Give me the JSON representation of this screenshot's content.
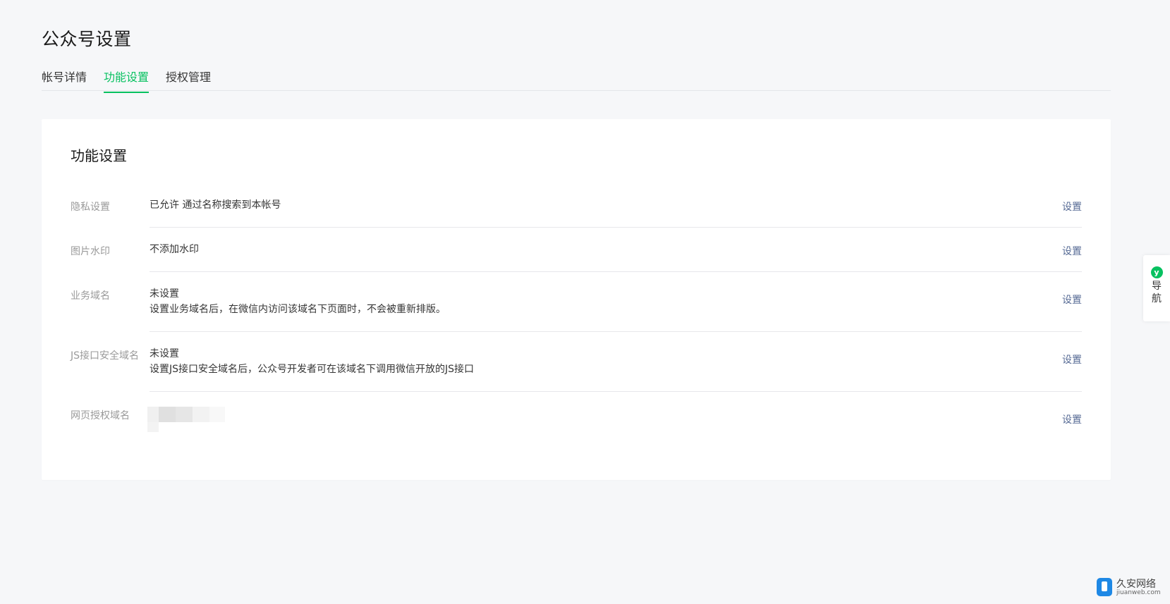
{
  "page": {
    "title": "公众号设置"
  },
  "tabs": [
    {
      "label": "帐号详情",
      "active": false
    },
    {
      "label": "功能设置",
      "active": true
    },
    {
      "label": "授权管理",
      "active": false
    }
  ],
  "card": {
    "title": "功能设置",
    "rows": [
      {
        "label": "隐私设置",
        "value": "已允许 通过名称搜索到本帐号",
        "desc": "",
        "action": "设置"
      },
      {
        "label": "图片水印",
        "value": "不添加水印",
        "desc": "",
        "action": "设置"
      },
      {
        "label": "业务域名",
        "value": "未设置",
        "desc": "设置业务域名后，在微信内访问该域名下页面时，不会被重新排版。",
        "action": "设置"
      },
      {
        "label": "JS接口安全域名",
        "value": "未设置",
        "desc": "设置JS接口安全域名后，公众号开发者可在该域名下调用微信开放的JS接口",
        "action": "设置"
      },
      {
        "label": "网页授权域名",
        "value": "",
        "desc": "",
        "action": "设置",
        "redacted": true
      }
    ]
  },
  "nav_float": {
    "text": "导航",
    "icon": "nav-badge-icon"
  },
  "watermark": {
    "name": "久安网络",
    "url": "jiuanweb.com"
  },
  "colors": {
    "accent": "#07c160",
    "link": "#576b95",
    "background": "#f6f7f9",
    "label": "#9a9a9a"
  }
}
